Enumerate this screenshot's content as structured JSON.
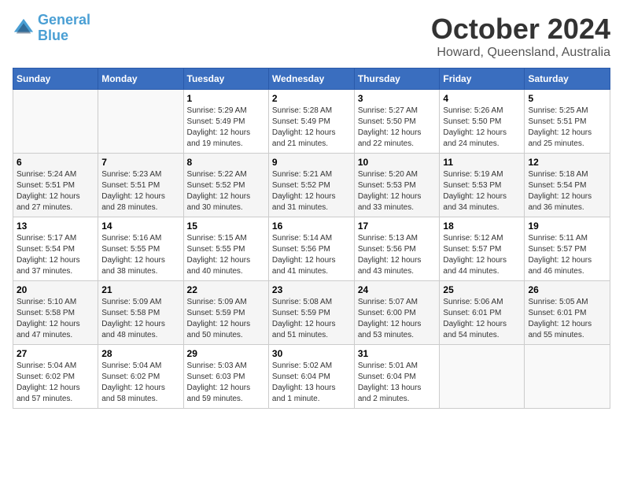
{
  "header": {
    "logo_line1": "General",
    "logo_line2": "Blue",
    "month": "October 2024",
    "location": "Howard, Queensland, Australia"
  },
  "weekdays": [
    "Sunday",
    "Monday",
    "Tuesday",
    "Wednesday",
    "Thursday",
    "Friday",
    "Saturday"
  ],
  "weeks": [
    [
      {
        "day": "",
        "info": ""
      },
      {
        "day": "",
        "info": ""
      },
      {
        "day": "1",
        "info": "Sunrise: 5:29 AM\nSunset: 5:49 PM\nDaylight: 12 hours and 19 minutes."
      },
      {
        "day": "2",
        "info": "Sunrise: 5:28 AM\nSunset: 5:49 PM\nDaylight: 12 hours and 21 minutes."
      },
      {
        "day": "3",
        "info": "Sunrise: 5:27 AM\nSunset: 5:50 PM\nDaylight: 12 hours and 22 minutes."
      },
      {
        "day": "4",
        "info": "Sunrise: 5:26 AM\nSunset: 5:50 PM\nDaylight: 12 hours and 24 minutes."
      },
      {
        "day": "5",
        "info": "Sunrise: 5:25 AM\nSunset: 5:51 PM\nDaylight: 12 hours and 25 minutes."
      }
    ],
    [
      {
        "day": "6",
        "info": "Sunrise: 5:24 AM\nSunset: 5:51 PM\nDaylight: 12 hours and 27 minutes."
      },
      {
        "day": "7",
        "info": "Sunrise: 5:23 AM\nSunset: 5:51 PM\nDaylight: 12 hours and 28 minutes."
      },
      {
        "day": "8",
        "info": "Sunrise: 5:22 AM\nSunset: 5:52 PM\nDaylight: 12 hours and 30 minutes."
      },
      {
        "day": "9",
        "info": "Sunrise: 5:21 AM\nSunset: 5:52 PM\nDaylight: 12 hours and 31 minutes."
      },
      {
        "day": "10",
        "info": "Sunrise: 5:20 AM\nSunset: 5:53 PM\nDaylight: 12 hours and 33 minutes."
      },
      {
        "day": "11",
        "info": "Sunrise: 5:19 AM\nSunset: 5:53 PM\nDaylight: 12 hours and 34 minutes."
      },
      {
        "day": "12",
        "info": "Sunrise: 5:18 AM\nSunset: 5:54 PM\nDaylight: 12 hours and 36 minutes."
      }
    ],
    [
      {
        "day": "13",
        "info": "Sunrise: 5:17 AM\nSunset: 5:54 PM\nDaylight: 12 hours and 37 minutes."
      },
      {
        "day": "14",
        "info": "Sunrise: 5:16 AM\nSunset: 5:55 PM\nDaylight: 12 hours and 38 minutes."
      },
      {
        "day": "15",
        "info": "Sunrise: 5:15 AM\nSunset: 5:55 PM\nDaylight: 12 hours and 40 minutes."
      },
      {
        "day": "16",
        "info": "Sunrise: 5:14 AM\nSunset: 5:56 PM\nDaylight: 12 hours and 41 minutes."
      },
      {
        "day": "17",
        "info": "Sunrise: 5:13 AM\nSunset: 5:56 PM\nDaylight: 12 hours and 43 minutes."
      },
      {
        "day": "18",
        "info": "Sunrise: 5:12 AM\nSunset: 5:57 PM\nDaylight: 12 hours and 44 minutes."
      },
      {
        "day": "19",
        "info": "Sunrise: 5:11 AM\nSunset: 5:57 PM\nDaylight: 12 hours and 46 minutes."
      }
    ],
    [
      {
        "day": "20",
        "info": "Sunrise: 5:10 AM\nSunset: 5:58 PM\nDaylight: 12 hours and 47 minutes."
      },
      {
        "day": "21",
        "info": "Sunrise: 5:09 AM\nSunset: 5:58 PM\nDaylight: 12 hours and 48 minutes."
      },
      {
        "day": "22",
        "info": "Sunrise: 5:09 AM\nSunset: 5:59 PM\nDaylight: 12 hours and 50 minutes."
      },
      {
        "day": "23",
        "info": "Sunrise: 5:08 AM\nSunset: 5:59 PM\nDaylight: 12 hours and 51 minutes."
      },
      {
        "day": "24",
        "info": "Sunrise: 5:07 AM\nSunset: 6:00 PM\nDaylight: 12 hours and 53 minutes."
      },
      {
        "day": "25",
        "info": "Sunrise: 5:06 AM\nSunset: 6:01 PM\nDaylight: 12 hours and 54 minutes."
      },
      {
        "day": "26",
        "info": "Sunrise: 5:05 AM\nSunset: 6:01 PM\nDaylight: 12 hours and 55 minutes."
      }
    ],
    [
      {
        "day": "27",
        "info": "Sunrise: 5:04 AM\nSunset: 6:02 PM\nDaylight: 12 hours and 57 minutes."
      },
      {
        "day": "28",
        "info": "Sunrise: 5:04 AM\nSunset: 6:02 PM\nDaylight: 12 hours and 58 minutes."
      },
      {
        "day": "29",
        "info": "Sunrise: 5:03 AM\nSunset: 6:03 PM\nDaylight: 12 hours and 59 minutes."
      },
      {
        "day": "30",
        "info": "Sunrise: 5:02 AM\nSunset: 6:04 PM\nDaylight: 13 hours and 1 minute."
      },
      {
        "day": "31",
        "info": "Sunrise: 5:01 AM\nSunset: 6:04 PM\nDaylight: 13 hours and 2 minutes."
      },
      {
        "day": "",
        "info": ""
      },
      {
        "day": "",
        "info": ""
      }
    ]
  ]
}
